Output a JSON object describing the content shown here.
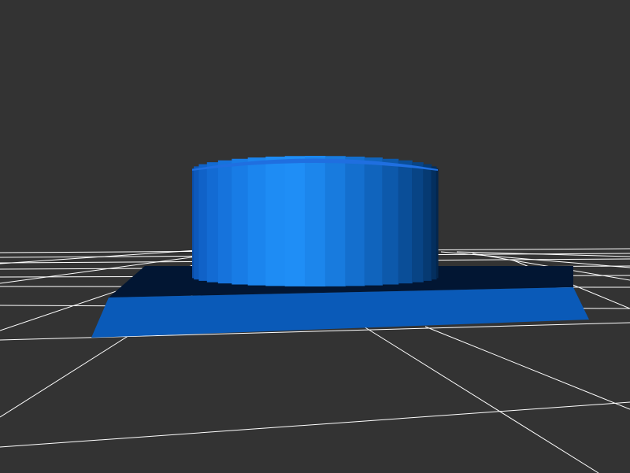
{
  "viewport": {
    "background_color": "#333333",
    "grid_color": "#ffffff"
  },
  "model": {
    "shape": "cylinder on rectangular base plate",
    "cylinder": {
      "top_color": "#1f6fe0",
      "body_colors": [
        "#0b4faa",
        "#0d59bb",
        "#1062c8",
        "#136bd3",
        "#1673dc",
        "#187ce6",
        "#1b85ee",
        "#1e8cf4",
        "#1f8ef6",
        "#1c86ec",
        "#187bde",
        "#146fce",
        "#1064bd",
        "#0d59ab",
        "#0a4e98",
        "#084485",
        "#063a72",
        "#042f5e",
        "#03264d"
      ]
    },
    "base": {
      "top_color": "#021633",
      "front_color": "#0a5ab8",
      "side_color": "#0a4f9e"
    }
  }
}
